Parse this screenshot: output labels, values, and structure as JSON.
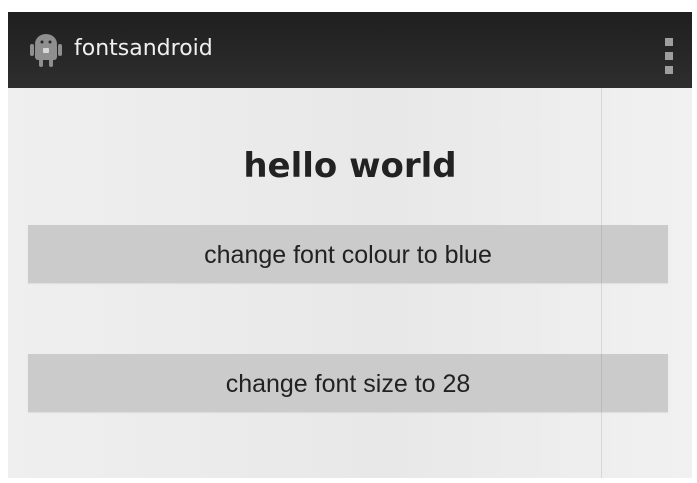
{
  "app": {
    "title": "fontsandroid",
    "icon": "android-icon",
    "menu_icon": "overflow-menu-icon"
  },
  "main": {
    "hello_text": "hello world",
    "buttons": [
      {
        "label": "change font colour to blue"
      },
      {
        "label": "change font size to 28"
      }
    ]
  },
  "colors": {
    "action_bar": "#262626",
    "background": "#ececec",
    "button": "#cbcbcb",
    "text": "#222222"
  }
}
